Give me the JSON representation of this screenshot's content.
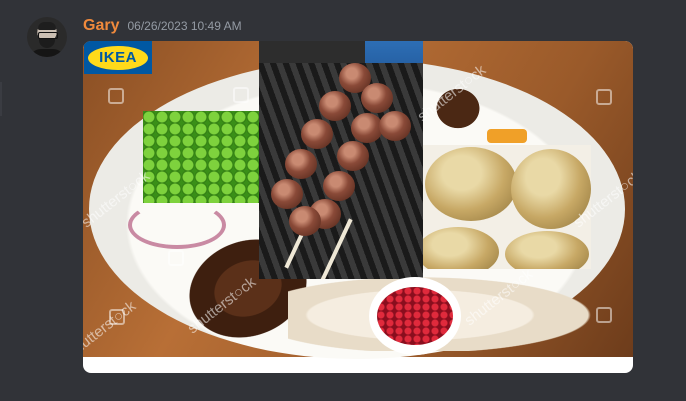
{
  "message": {
    "username": "Gary",
    "timestamp": "06/26/2023 10:49 AM",
    "username_color": "#f08a3c"
  },
  "attachment": {
    "logo_text": "IKEA",
    "logo_colors": {
      "background": "#0058a3",
      "oval": "#ffda1a"
    },
    "watermark": "shutterst○ck",
    "icons": [
      "avatar",
      "ikea-logo",
      "shutterstock-watermark-icon"
    ]
  },
  "theme": {
    "background": "#313338",
    "timestamp_color": "#949ba4"
  }
}
